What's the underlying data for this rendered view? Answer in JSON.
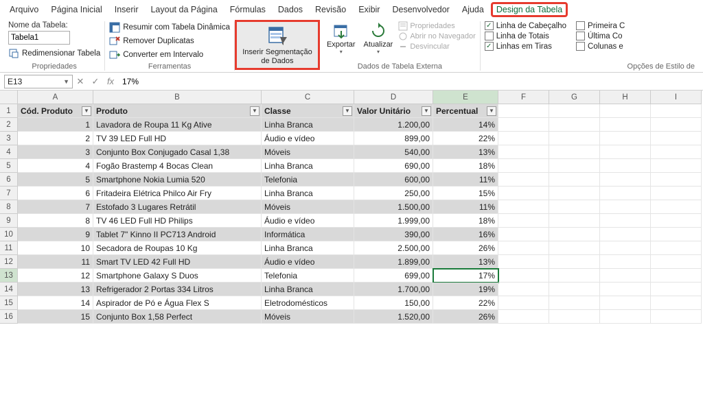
{
  "menu": {
    "items": [
      "Arquivo",
      "Página Inicial",
      "Inserir",
      "Layout da Página",
      "Fórmulas",
      "Dados",
      "Revisão",
      "Exibir",
      "Desenvolvedor",
      "Ajuda",
      "Design da Tabela"
    ],
    "activeIndex": 10
  },
  "ribbon": {
    "properties": {
      "nameLabel": "Nome da Tabela:",
      "tableName": "Tabela1",
      "resize": "Redimensionar Tabela",
      "groupLabel": "Propriedades"
    },
    "tools": {
      "pivot": "Resumir com Tabela Dinâmica",
      "dedupe": "Remover Duplicatas",
      "convert": "Converter em Intervalo",
      "groupLabel": "Ferramentas"
    },
    "slicer": {
      "label": "Inserir Segmentação de Dados"
    },
    "external": {
      "export": "Exportar",
      "refresh": "Atualizar",
      "props": "Propriedades",
      "browser": "Abrir no Navegador",
      "unlink": "Desvincular",
      "groupLabel": "Dados de Tabela Externa"
    },
    "styleOptions": {
      "header": "Linha de Cabeçalho",
      "total": "Linha de Totais",
      "banded": "Linhas em Tiras",
      "firstCol": "Primeira C",
      "lastCol": "Última Co",
      "bandedCol": "Colunas e",
      "groupLabel": "Opções de Estilo de"
    }
  },
  "formulaBar": {
    "cellRef": "E13",
    "formula": "17%"
  },
  "columns": [
    "A",
    "B",
    "C",
    "D",
    "E",
    "F",
    "G",
    "H",
    "I"
  ],
  "headers": [
    "Cód. Produto",
    "Produto",
    "Classe",
    "Valor Unitário",
    "Percentual"
  ],
  "rows": [
    {
      "n": 1,
      "cod": "1",
      "prod": "Lavadora de Roupa 11 Kg Ative",
      "cls": "Linha Branca",
      "val": "1.200,00",
      "pct": "14%"
    },
    {
      "n": 2,
      "cod": "2",
      "prod": "TV 39 LED Full HD",
      "cls": "Áudio e vídeo",
      "val": "899,00",
      "pct": "22%"
    },
    {
      "n": 3,
      "cod": "3",
      "prod": "Conjunto Box Conjugado Casal 1,38",
      "cls": "Móveis",
      "val": "540,00",
      "pct": "13%"
    },
    {
      "n": 4,
      "cod": "4",
      "prod": "Fogão Brastemp 4 Bocas Clean",
      "cls": "Linha Branca",
      "val": "690,00",
      "pct": "18%"
    },
    {
      "n": 5,
      "cod": "5",
      "prod": "Smartphone Nokia Lumia 520",
      "cls": "Telefonia",
      "val": "600,00",
      "pct": "11%"
    },
    {
      "n": 6,
      "cod": "6",
      "prod": "Fritadeira Elétrica Philco Air Fry",
      "cls": "Linha Branca",
      "val": "250,00",
      "pct": "15%"
    },
    {
      "n": 7,
      "cod": "7",
      "prod": "Estofado 3 Lugares Retrátil",
      "cls": "Móveis",
      "val": "1.500,00",
      "pct": "11%"
    },
    {
      "n": 8,
      "cod": "8",
      "prod": "TV 46 LED Full HD Philips",
      "cls": "Áudio e vídeo",
      "val": "1.999,00",
      "pct": "18%"
    },
    {
      "n": 9,
      "cod": "9",
      "prod": "Tablet 7\" Kinno II PC713 Android",
      "cls": "Informática",
      "val": "390,00",
      "pct": "16%"
    },
    {
      "n": 10,
      "cod": "10",
      "prod": "Secadora de Roupas 10 Kg",
      "cls": "Linha Branca",
      "val": "2.500,00",
      "pct": "26%"
    },
    {
      "n": 11,
      "cod": "11",
      "prod": "Smart TV LED 42 Full HD",
      "cls": "Áudio e vídeo",
      "val": "1.899,00",
      "pct": "13%"
    },
    {
      "n": 12,
      "cod": "12",
      "prod": "Smartphone Galaxy S Duos",
      "cls": "Telefonia",
      "val": "699,00",
      "pct": "17%"
    },
    {
      "n": 13,
      "cod": "13",
      "prod": "Refrigerador 2 Portas 334 Litros",
      "cls": "Linha Branca",
      "val": "1.700,00",
      "pct": "19%"
    },
    {
      "n": 14,
      "cod": "14",
      "prod": "Aspirador de Pó e Água Flex S",
      "cls": "Eletrodomésticos",
      "val": "150,00",
      "pct": "22%"
    },
    {
      "n": 15,
      "cod": "15",
      "prod": "Conjunto Box 1,58 Perfect",
      "cls": "Móveis",
      "val": "1.520,00",
      "pct": "26%"
    }
  ],
  "selectedRow": 13,
  "selectedCol": "E"
}
